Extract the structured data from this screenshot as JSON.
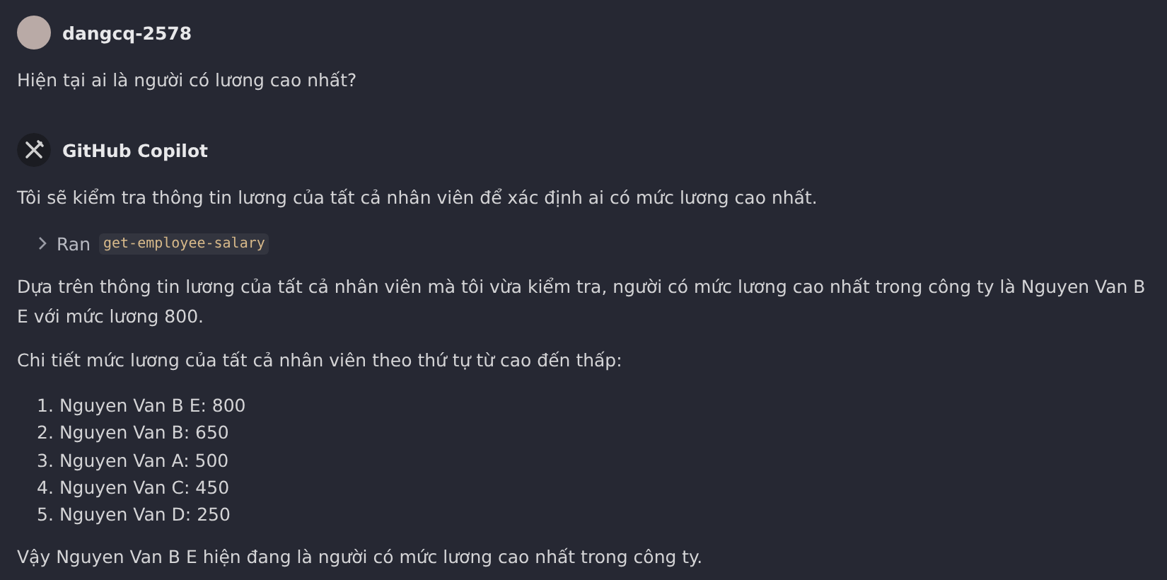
{
  "messages": [
    {
      "kind": "user",
      "author": "dangcq-2578",
      "blocks": [
        {
          "kind": "paragraph",
          "text": "Hiện tại ai là người có lương cao nhất?"
        }
      ]
    },
    {
      "kind": "assistant",
      "author": "GitHub Copilot",
      "blocks": [
        {
          "kind": "paragraph",
          "text": "Tôi sẽ kiểm tra thông tin lương của tất cả nhân viên để xác định ai có mức lương cao nhất."
        },
        {
          "kind": "tool",
          "label": "Ran",
          "tool": "get-employee-salary",
          "expanded": false
        },
        {
          "kind": "paragraph",
          "text": "Dựa trên thông tin lương của tất cả nhân viên mà tôi vừa kiểm tra, người có mức lương cao nhất trong công ty là Nguyen Van B E với mức lương 800."
        },
        {
          "kind": "paragraph",
          "text": "Chi tiết mức lương của tất cả nhân viên theo thứ tự từ cao đến thấp:"
        },
        {
          "kind": "list",
          "items": [
            {
              "number": "1.",
              "text": "Nguyen Van B E: 800"
            },
            {
              "number": "2.",
              "text": "Nguyen Van B: 650"
            },
            {
              "number": "3.",
              "text": "Nguyen Van A: 500"
            },
            {
              "number": "4.",
              "text": "Nguyen Van C: 450"
            },
            {
              "number": "5.",
              "text": "Nguyen Van D: 250"
            }
          ]
        },
        {
          "kind": "paragraph",
          "text": "Vậy Nguyen Van B E hiện đang là người có mức lương cao nhất trong công ty."
        }
      ]
    }
  ]
}
